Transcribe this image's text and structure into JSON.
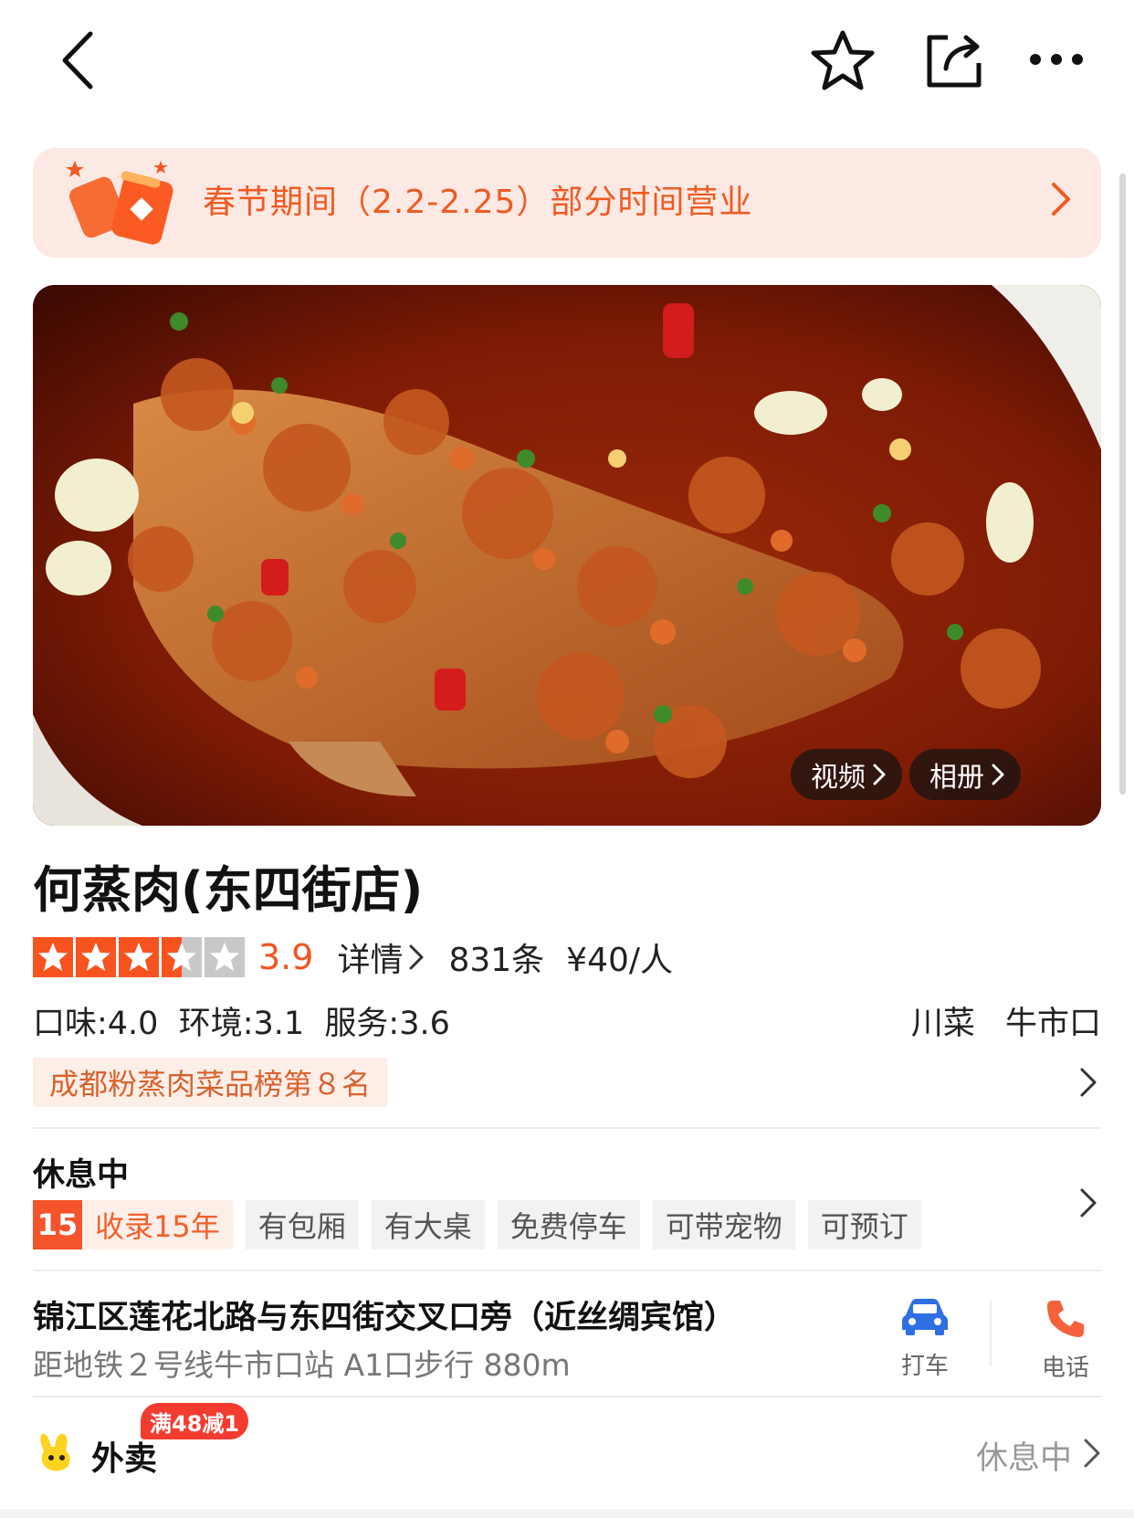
{
  "header": {
    "back_icon": "chevron-left-icon",
    "favorite_icon": "star-outline-icon",
    "share_icon": "share-icon",
    "more_icon": "more-horizontal-icon"
  },
  "banner": {
    "text": "春节期间（2.2-2.25）部分时间营业",
    "icon": "firecracker-icon"
  },
  "photo": {
    "video_label": "视频",
    "album_label": "相册"
  },
  "shop": {
    "name": "何蒸肉(东四街店)",
    "stars": 3.5,
    "rating": "3.9",
    "detail_label": "详情",
    "review_count": "831条",
    "price": "¥40/人",
    "scores": "口味:4.0  环境:3.1  服务:3.6",
    "cuisine": "川菜",
    "area": "牛市口",
    "rank_tag": "成都粉蒸肉菜品榜第８名"
  },
  "status": {
    "open_state": "休息中",
    "year_badge": "15",
    "tags": [
      "收录15年",
      "有包厢",
      "有大桌",
      "免费停车",
      "可带宠物",
      "可预订"
    ]
  },
  "address": {
    "line": "锦江区莲花北路与东四街交叉口旁（近丝绸宾馆）",
    "metro": "距地铁２号线牛市口站 A1口步行 880m",
    "taxi_label": "打车",
    "phone_label": "电话"
  },
  "takeout": {
    "label": "外卖",
    "promo": "满48减1",
    "status": "休息中"
  },
  "colors": {
    "accent": "#f15a22",
    "rating": "#f7531f",
    "taxi_blue": "#2f6fe4",
    "phone_orange": "#f5613a"
  }
}
